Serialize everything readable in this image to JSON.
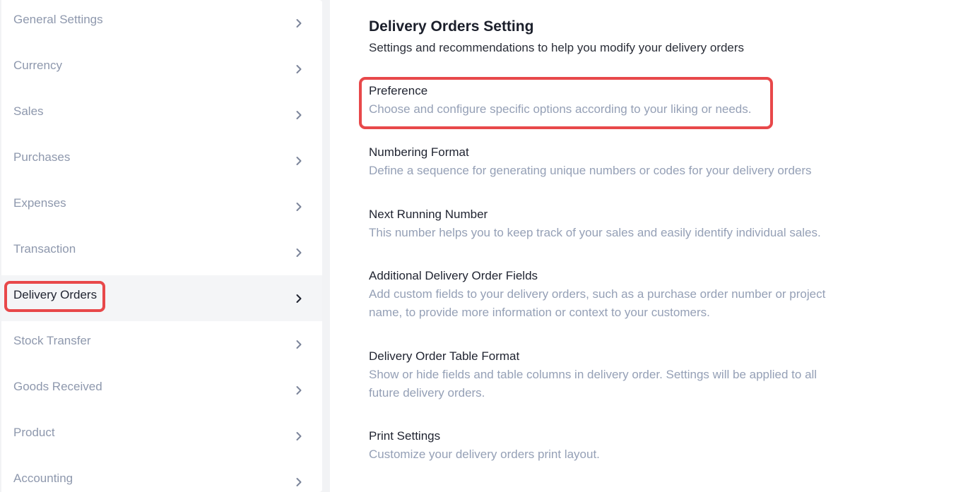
{
  "sidebar": {
    "items": [
      {
        "label": "General Settings"
      },
      {
        "label": "Currency"
      },
      {
        "label": "Sales"
      },
      {
        "label": "Purchases"
      },
      {
        "label": "Expenses"
      },
      {
        "label": "Transaction"
      },
      {
        "label": "Delivery Orders",
        "active": true
      },
      {
        "label": "Stock Transfer"
      },
      {
        "label": "Goods Received"
      },
      {
        "label": "Product"
      },
      {
        "label": "Accounting"
      }
    ]
  },
  "main": {
    "title": "Delivery Orders Setting",
    "subtitle": "Settings and recommendations to help you modify your delivery orders",
    "options": [
      {
        "title": "Preference",
        "desc": "Choose and configure specific options according to your liking or needs."
      },
      {
        "title": "Numbering Format",
        "desc": "Define a sequence for generating unique numbers or codes for your delivery orders"
      },
      {
        "title": "Next Running Number",
        "desc": "This number helps you to keep track of your sales and easily identify individual sales."
      },
      {
        "title": "Additional Delivery Order Fields",
        "desc": "Add custom fields to your delivery orders, such as a purchase order number or project name, to provide more information or context to your customers."
      },
      {
        "title": "Delivery Order Table Format",
        "desc": "Show or hide fields and table columns in delivery order. Settings will be applied to all future delivery orders."
      },
      {
        "title": "Print Settings",
        "desc": "Customize your delivery orders print layout."
      }
    ]
  },
  "colors": {
    "highlight": "#e8484a",
    "muted_text": "#95a0b6",
    "primary_text": "#1f2330"
  },
  "icons": {
    "chevron": "chevron-right-icon"
  }
}
